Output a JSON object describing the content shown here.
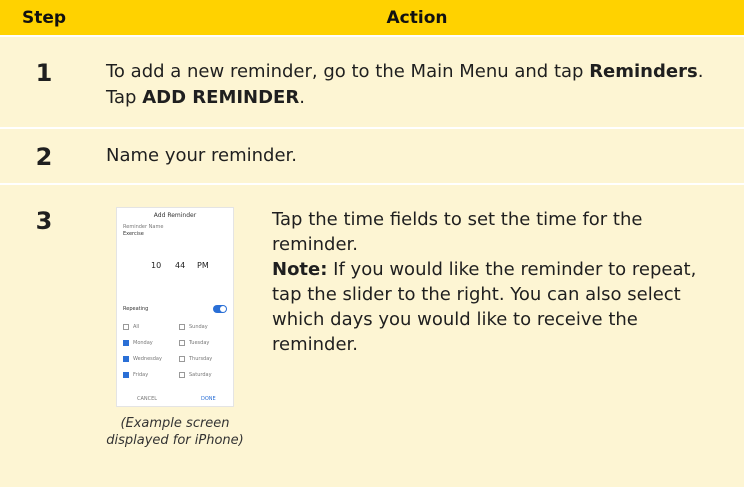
{
  "header": {
    "step": "Step",
    "action": "Action"
  },
  "rows": [
    {
      "step": "1",
      "text_a": "To add a new reminder, go to the Main Menu and tap ",
      "bold_a": "Reminders",
      "text_b": ". Tap ",
      "bold_b": "ADD REMINDER",
      "text_c": "."
    },
    {
      "step": "2",
      "text": "Name your reminder."
    },
    {
      "step": "3",
      "desc": "Tap the time fields to set the time for the reminder.",
      "note_label": "Note:",
      "note": " If you would like the reminder to repeat, tap the slider to the right. You can also select which days you would like to receive the reminder.",
      "caption": "(Example screen displayed for iPhone)"
    }
  ],
  "phone": {
    "title": "Add Reminder",
    "name_label": "Reminder Name",
    "name_value": "Exercise",
    "time": {
      "hour": "10",
      "minute": "44",
      "ampm": "PM"
    },
    "repeating_label": "Repeating",
    "days": [
      {
        "label": "All",
        "checked": false
      },
      {
        "label": "Sunday",
        "checked": false
      },
      {
        "label": "Monday",
        "checked": true
      },
      {
        "label": "Tuesday",
        "checked": false
      },
      {
        "label": "Wednesday",
        "checked": true
      },
      {
        "label": "Thursday",
        "checked": false
      },
      {
        "label": "Friday",
        "checked": true
      },
      {
        "label": "Saturday",
        "checked": false
      }
    ],
    "cancel": "CANCEL",
    "done": "DONE",
    "accent": "#2a6fd6"
  },
  "colors": {
    "header": "#ffd200",
    "row": "#fdf5d3"
  }
}
